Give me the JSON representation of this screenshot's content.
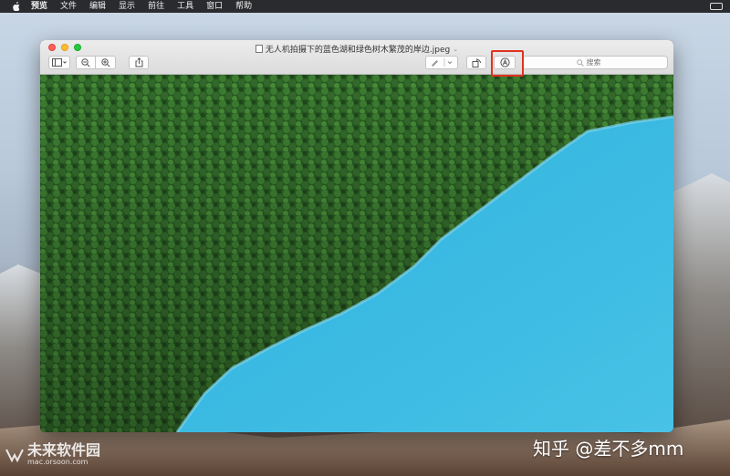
{
  "menubar": {
    "app_name": "预览",
    "items": [
      "文件",
      "编辑",
      "显示",
      "前往",
      "工具",
      "窗口",
      "帮助"
    ]
  },
  "window": {
    "title": "无人机拍摄下的蓝色湖和绿色树木繁茂的岸边.jpeg",
    "search_placeholder": "搜索"
  },
  "colors": {
    "lake": "#3db8e0",
    "forest": "#2f6b2a",
    "highlight": "#e0321e"
  },
  "icons": [
    "apple-icon",
    "sidebar-icon",
    "zoom-out-icon",
    "zoom-in-icon",
    "share-icon",
    "pen-icon",
    "rotate-icon",
    "markup-icon",
    "search-icon"
  ],
  "watermarks": {
    "zhihu": "知乎 @差不多mm",
    "logo_cn": "未来软件园",
    "logo_url": "mac.orsoon.com"
  }
}
